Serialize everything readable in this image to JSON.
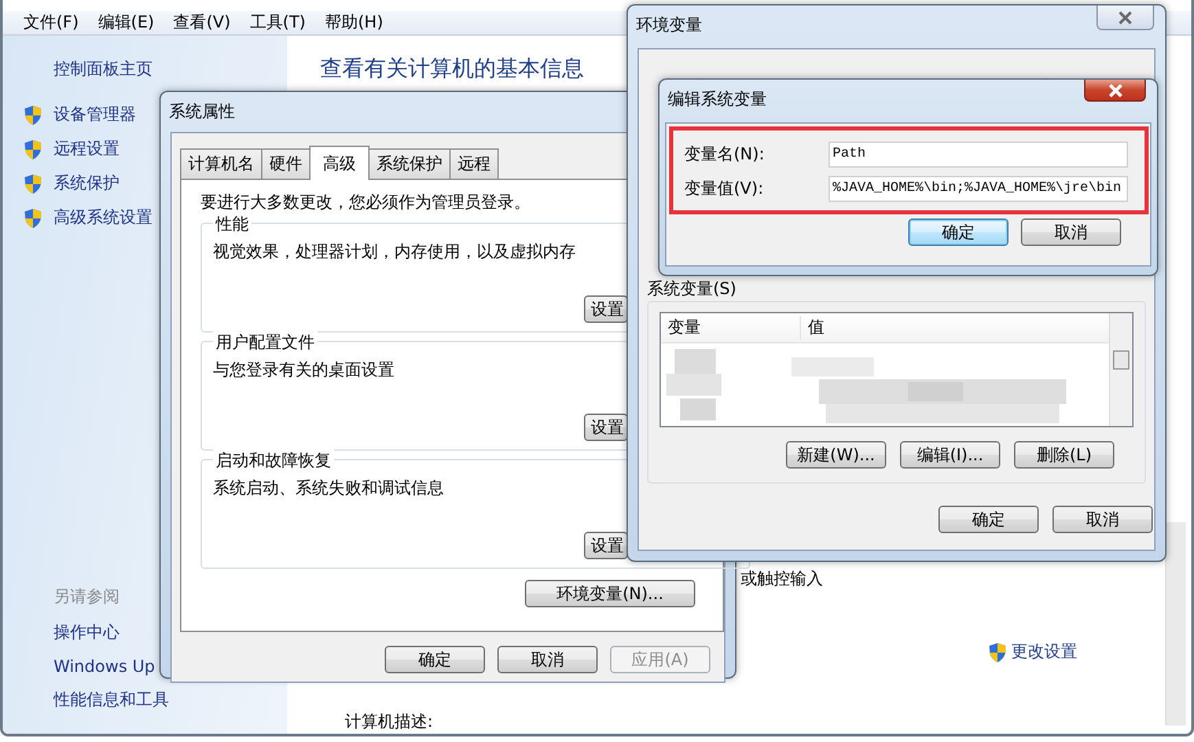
{
  "control_panel": {
    "menu": [
      "文件(F)",
      "编辑(E)",
      "查看(V)",
      "工具(T)",
      "帮助(H)"
    ],
    "sidebar": {
      "home_link": "控制面板主页",
      "tasks": [
        "设备管理器",
        "远程设置",
        "系统保护",
        "高级系统设置"
      ],
      "see_also_title": "另请参阅",
      "see_also": [
        "操作中心",
        "Windows Up",
        "性能信息和工具"
      ]
    },
    "heading": "查看有关计算机的基本信息",
    "partial_text": "或触控输入",
    "change_settings_link": "更改设置",
    "computer_description_label": "计算机描述:"
  },
  "system_properties": {
    "title": "系统属性",
    "tabs": [
      {
        "label": "计算机名",
        "selected": false
      },
      {
        "label": "硬件",
        "selected": false
      },
      {
        "label": "高级",
        "selected": true
      },
      {
        "label": "系统保护",
        "selected": false
      },
      {
        "label": "远程",
        "selected": false
      }
    ],
    "notice": "要进行大多数更改，您必须作为管理员登录。",
    "groups": [
      {
        "title": "性能",
        "description": "视觉效果，处理器计划，内存使用，以及虚拟内存",
        "button": "设置"
      },
      {
        "title": "用户配置文件",
        "description": "与您登录有关的桌面设置",
        "button": "设置"
      },
      {
        "title": "启动和故障恢复",
        "description": "系统启动、系统失败和调试信息",
        "button": "设置"
      }
    ],
    "env_button": "环境变量(N)...",
    "buttons": [
      {
        "label": "确定",
        "disabled": false
      },
      {
        "label": "取消",
        "disabled": false
      },
      {
        "label": "应用(A)",
        "disabled": true
      }
    ]
  },
  "environment_variables": {
    "title": "环境变量",
    "system_variables_label": "系统变量(S)",
    "columns": [
      "变量",
      "值"
    ],
    "list_buttons": [
      "新建(W)...",
      "编辑(I)...",
      "删除(L)"
    ],
    "buttons": [
      "确定",
      "取消"
    ]
  },
  "edit_dialog": {
    "title": "编辑系统变量",
    "fields": [
      {
        "label": "变量名(N):",
        "value": "Path"
      },
      {
        "label": "变量值(V):",
        "value": "%JAVA_HOME%\\bin;%JAVA_HOME%\\jre\\bin"
      }
    ],
    "buttons": [
      {
        "label": "确定",
        "default": true
      },
      {
        "label": "取消",
        "default": false
      }
    ]
  }
}
